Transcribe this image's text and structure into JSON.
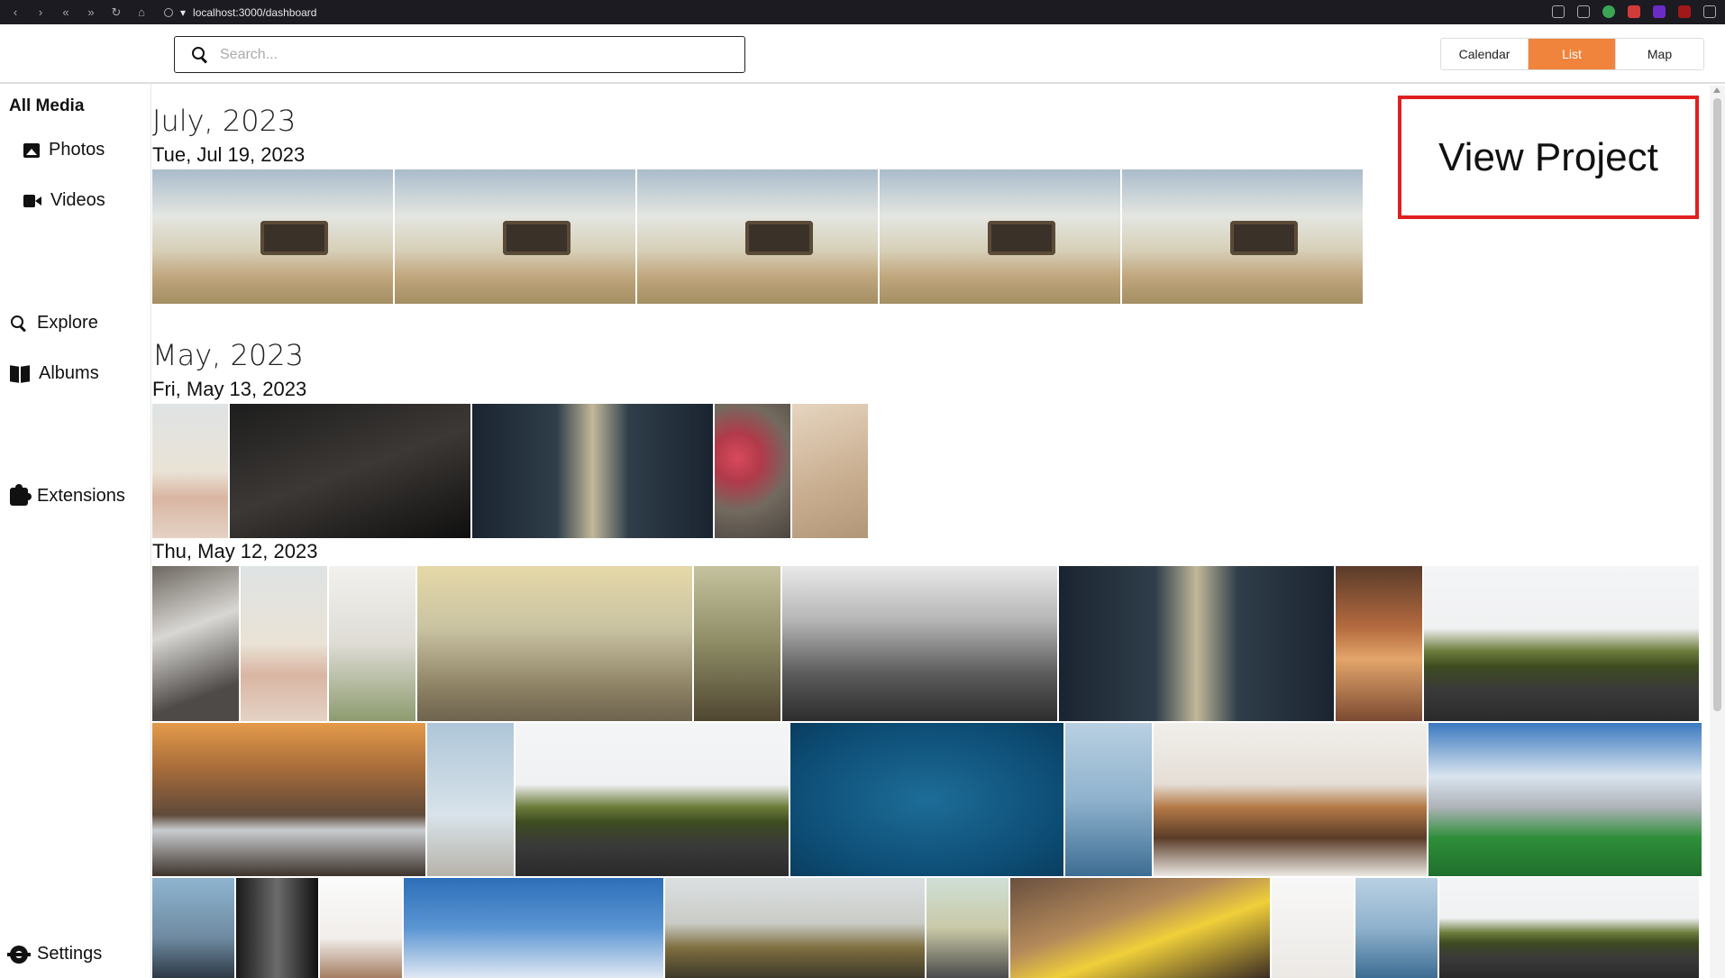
{
  "browser": {
    "url": "localhost:3000/dashboard"
  },
  "search": {
    "placeholder": "Search..."
  },
  "view_toggle": {
    "calendar": "Calendar",
    "list": "List",
    "map": "Map",
    "active": "List",
    "active_color": "#f0843c"
  },
  "sidebar": {
    "heading": "All Media",
    "items": [
      {
        "label": "Photos",
        "icon": "photo-icon"
      },
      {
        "label": "Videos",
        "icon": "video-icon"
      },
      {
        "label": "Explore",
        "icon": "search-icon"
      },
      {
        "label": "Albums",
        "icon": "book-icon"
      },
      {
        "label": "Extensions",
        "icon": "puzzle-icon"
      },
      {
        "label": "Settings",
        "icon": "gear-icon"
      }
    ]
  },
  "timeline": {
    "groups": [
      {
        "month": "July, 2023",
        "days": [
          {
            "date": "Tue, Jul 19, 2023"
          }
        ]
      },
      {
        "month": "May, 2023",
        "days": [
          {
            "date": "Fri, May 13, 2023"
          },
          {
            "date": "Thu, May 12, 2023"
          }
        ]
      }
    ]
  },
  "overlay": {
    "label": "View Project",
    "border_color": "#e02020"
  }
}
